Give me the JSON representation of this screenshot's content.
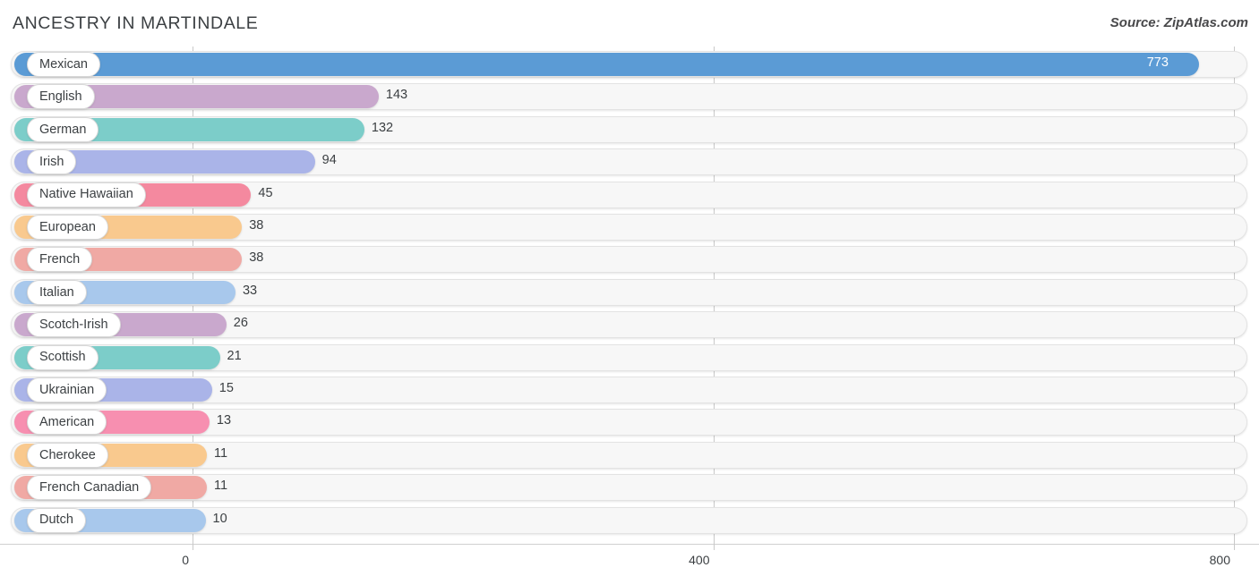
{
  "header": {
    "title": "ANCESTRY IN MARTINDALE",
    "source": "Source: ZipAtlas.com"
  },
  "axis": {
    "ticks": [
      "0",
      "400",
      "800"
    ]
  },
  "chart_data": {
    "type": "bar",
    "orientation": "horizontal",
    "title": "ANCESTRY IN MARTINDALE",
    "subtitle": "Source: ZipAtlas.com",
    "xlabel": "",
    "ylabel": "",
    "xlim": [
      0,
      800
    ],
    "xticks": [
      0,
      400,
      800
    ],
    "grid": true,
    "legend": false,
    "categories": [
      "Mexican",
      "English",
      "German",
      "Irish",
      "Native Hawaiian",
      "European",
      "French",
      "Italian",
      "Scotch-Irish",
      "Scottish",
      "Ukrainian",
      "American",
      "Cherokee",
      "French Canadian",
      "Dutch"
    ],
    "values": [
      773,
      143,
      132,
      94,
      45,
      38,
      38,
      33,
      26,
      21,
      15,
      13,
      11,
      11,
      10
    ],
    "value_labels": [
      "773",
      "143",
      "132",
      "94",
      "45",
      "38",
      "38",
      "33",
      "26",
      "21",
      "15",
      "13",
      "11",
      "11",
      "10"
    ],
    "colors": [
      "#5b9bd5",
      "#c9a8cd",
      "#7ccdc9",
      "#aab4e8",
      "#f4899f",
      "#f9c98e",
      "#f0a9a4",
      "#a8c8ec",
      "#c9a8cd",
      "#7ccdc9",
      "#aab4e8",
      "#f78fb0",
      "#f9c98e",
      "#f0a9a4",
      "#a8c8ec"
    ],
    "track_color": "#f7f7f7",
    "label_pill_color": "#ffffff"
  }
}
